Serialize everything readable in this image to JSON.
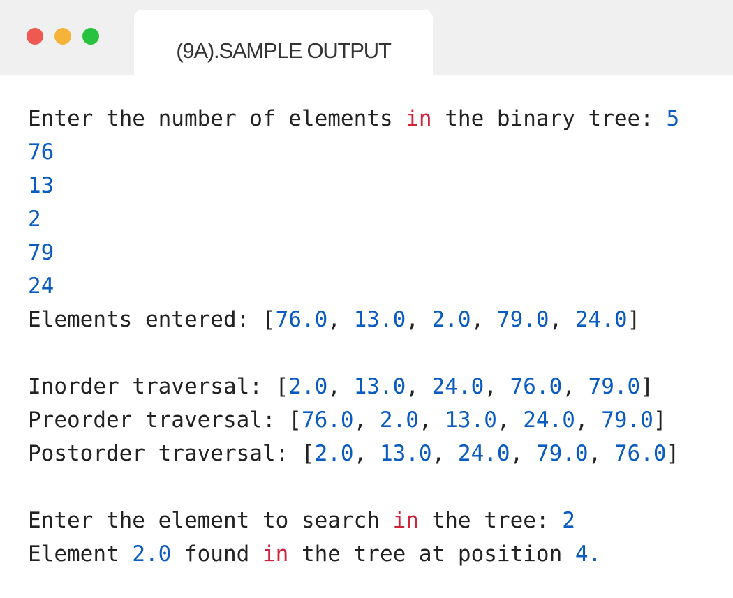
{
  "window": {
    "title": "(9A).SAMPLE OUTPUT",
    "controls": {
      "close_color": "#ee5a52",
      "minimize_color": "#f6b33a",
      "maximize_color": "#27c23f"
    }
  },
  "colors": {
    "plain": "#222222",
    "number": "#0b5cc0",
    "keyword": "#d0243c"
  },
  "console_lines": [
    [
      [
        "plain",
        "Enter the number of elements "
      ],
      [
        "keyword",
        "in"
      ],
      [
        "plain",
        " the binary tree: "
      ],
      [
        "number",
        "5"
      ]
    ],
    [
      [
        "number",
        "76"
      ]
    ],
    [
      [
        "number",
        "13"
      ]
    ],
    [
      [
        "number",
        "2"
      ]
    ],
    [
      [
        "number",
        "79"
      ]
    ],
    [
      [
        "number",
        "24"
      ]
    ],
    [
      [
        "plain",
        "Elements entered: ["
      ],
      [
        "number",
        "76.0"
      ],
      [
        "plain",
        ", "
      ],
      [
        "number",
        "13.0"
      ],
      [
        "plain",
        ", "
      ],
      [
        "number",
        "2.0"
      ],
      [
        "plain",
        ", "
      ],
      [
        "number",
        "79.0"
      ],
      [
        "plain",
        ", "
      ],
      [
        "number",
        "24.0"
      ],
      [
        "plain",
        "]"
      ]
    ],
    [],
    [
      [
        "plain",
        "Inorder traversal: ["
      ],
      [
        "number",
        "2.0"
      ],
      [
        "plain",
        ", "
      ],
      [
        "number",
        "13.0"
      ],
      [
        "plain",
        ", "
      ],
      [
        "number",
        "24.0"
      ],
      [
        "plain",
        ", "
      ],
      [
        "number",
        "76.0"
      ],
      [
        "plain",
        ", "
      ],
      [
        "number",
        "79.0"
      ],
      [
        "plain",
        "]"
      ]
    ],
    [
      [
        "plain",
        "Preorder traversal: ["
      ],
      [
        "number",
        "76.0"
      ],
      [
        "plain",
        ", "
      ],
      [
        "number",
        "2.0"
      ],
      [
        "plain",
        ", "
      ],
      [
        "number",
        "13.0"
      ],
      [
        "plain",
        ", "
      ],
      [
        "number",
        "24.0"
      ],
      [
        "plain",
        ", "
      ],
      [
        "number",
        "79.0"
      ],
      [
        "plain",
        "]"
      ]
    ],
    [
      [
        "plain",
        "Postorder traversal: ["
      ],
      [
        "number",
        "2.0"
      ],
      [
        "plain",
        ", "
      ],
      [
        "number",
        "13.0"
      ],
      [
        "plain",
        ", "
      ],
      [
        "number",
        "24.0"
      ],
      [
        "plain",
        ", "
      ],
      [
        "number",
        "79.0"
      ],
      [
        "plain",
        ", "
      ],
      [
        "number",
        "76.0"
      ],
      [
        "plain",
        "]"
      ]
    ],
    [],
    [
      [
        "plain",
        "Enter the element to search "
      ],
      [
        "keyword",
        "in"
      ],
      [
        "plain",
        " the tree: "
      ],
      [
        "number",
        "2"
      ]
    ],
    [
      [
        "plain",
        "Element "
      ],
      [
        "number",
        "2.0"
      ],
      [
        "plain",
        " found "
      ],
      [
        "keyword",
        "in"
      ],
      [
        "plain",
        " the tree at position "
      ],
      [
        "number",
        "4."
      ]
    ]
  ]
}
